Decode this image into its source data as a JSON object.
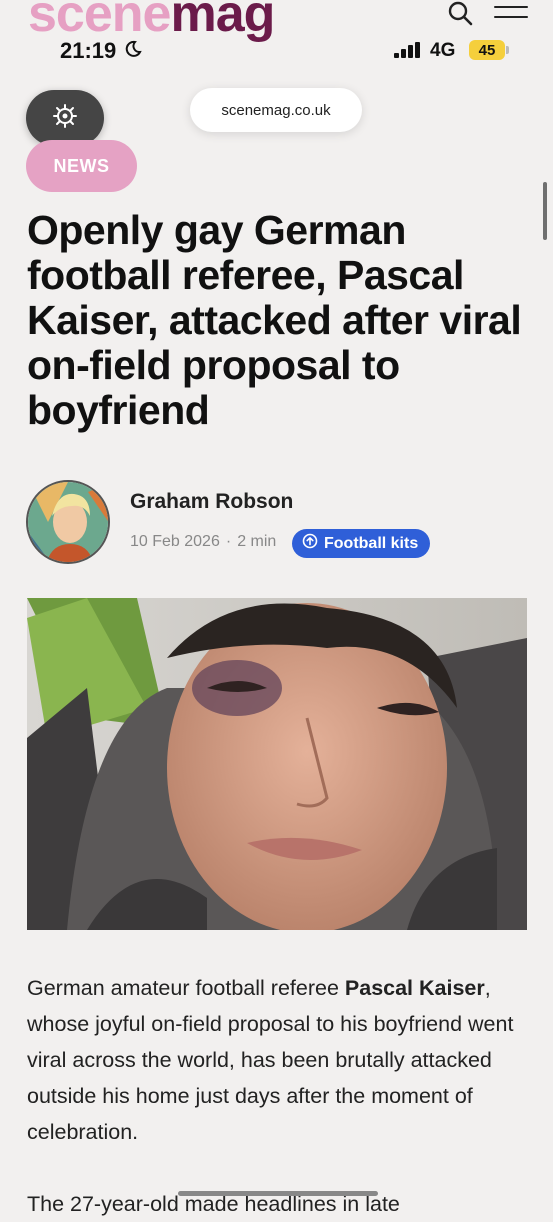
{
  "site": {
    "logo_part1": "scene",
    "logo_part2": "mag",
    "brand_pink": "#e6a0c3",
    "brand_plum": "#6b1b4a",
    "icons": [
      "search-icon",
      "hamburger-menu-icon"
    ]
  },
  "status_bar": {
    "time": "21:19",
    "network": "4G",
    "battery": "45",
    "icons": [
      "moon-icon",
      "signal-icon"
    ]
  },
  "browser": {
    "url": "scenemag.co.uk",
    "tools_icon": "settings-sparkle-icon"
  },
  "article": {
    "category": "NEWS",
    "category_color": "#e5a2c4",
    "headline": "Openly gay German football referee, Pascal Kaiser, attacked after viral on-field proposal to boyfriend",
    "author": "Graham Robson",
    "date": "10 Feb 2026",
    "separator": "·",
    "read_time": "2 min",
    "tag": "Football kits",
    "tag_color": "#2f5fd8",
    "body_1_pre": "German amateur football referee ",
    "body_1_bold": "Pascal Kaiser",
    "body_1_post": ", whose joyful on-field proposal to his boyfriend went viral across the world, has been brutally attacked outside his home just days after the moment of celebration.",
    "body_2": "The 27-year-old made headlines in late"
  }
}
